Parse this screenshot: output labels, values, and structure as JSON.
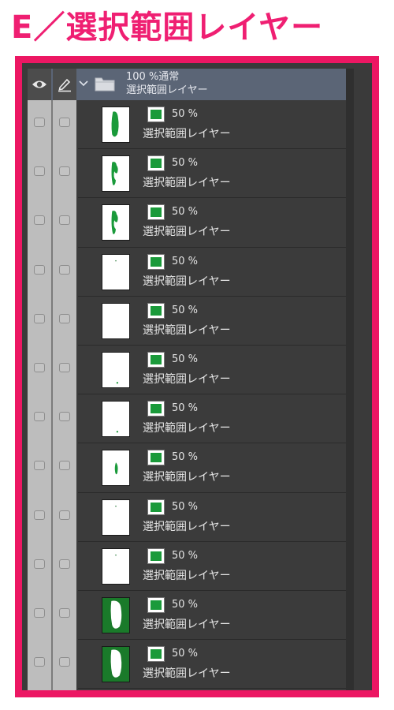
{
  "heading": "E／選択範囲レイヤー",
  "colors": {
    "frame_border": "#ec1763",
    "heading_text": "#ef1f72",
    "layer_color": "#1a9a3a",
    "panel_background": "#3b3b3b",
    "header_selected": "#5b6576"
  },
  "panel": {
    "header": {
      "icons": [
        "eye-icon",
        "pen-icon",
        "chevron-down-icon",
        "folder-icon"
      ],
      "blend": "100 %通常",
      "name": "選択範囲レイヤー"
    },
    "layers": [
      {
        "opacity": "50 %",
        "name": "選択範囲レイヤー",
        "thumb": "mostly-green"
      },
      {
        "opacity": "50 %",
        "name": "選択範囲レイヤー",
        "thumb": "partial-green"
      },
      {
        "opacity": "50 %",
        "name": "選択範囲レイヤー",
        "thumb": "partial-green"
      },
      {
        "opacity": "50 %",
        "name": "選択範囲レイヤー",
        "thumb": "white-speck"
      },
      {
        "opacity": "50 %",
        "name": "選択範囲レイヤー",
        "thumb": "white"
      },
      {
        "opacity": "50 %",
        "name": "選択範囲レイヤー",
        "thumb": "white-dot-bottom"
      },
      {
        "opacity": "50 %",
        "name": "選択範囲レイヤー",
        "thumb": "white-dot-bottom"
      },
      {
        "opacity": "50 %",
        "name": "選択範囲レイヤー",
        "thumb": "small-green"
      },
      {
        "opacity": "50 %",
        "name": "選択範囲レイヤー",
        "thumb": "white-speck"
      },
      {
        "opacity": "50 %",
        "name": "選択範囲レイヤー",
        "thumb": "white-speck"
      },
      {
        "opacity": "50 %",
        "name": "選択範囲レイヤー",
        "thumb": "green-bg-white"
      },
      {
        "opacity": "50 %",
        "name": "選択範囲レイヤー",
        "thumb": "green-bg-white"
      }
    ]
  }
}
